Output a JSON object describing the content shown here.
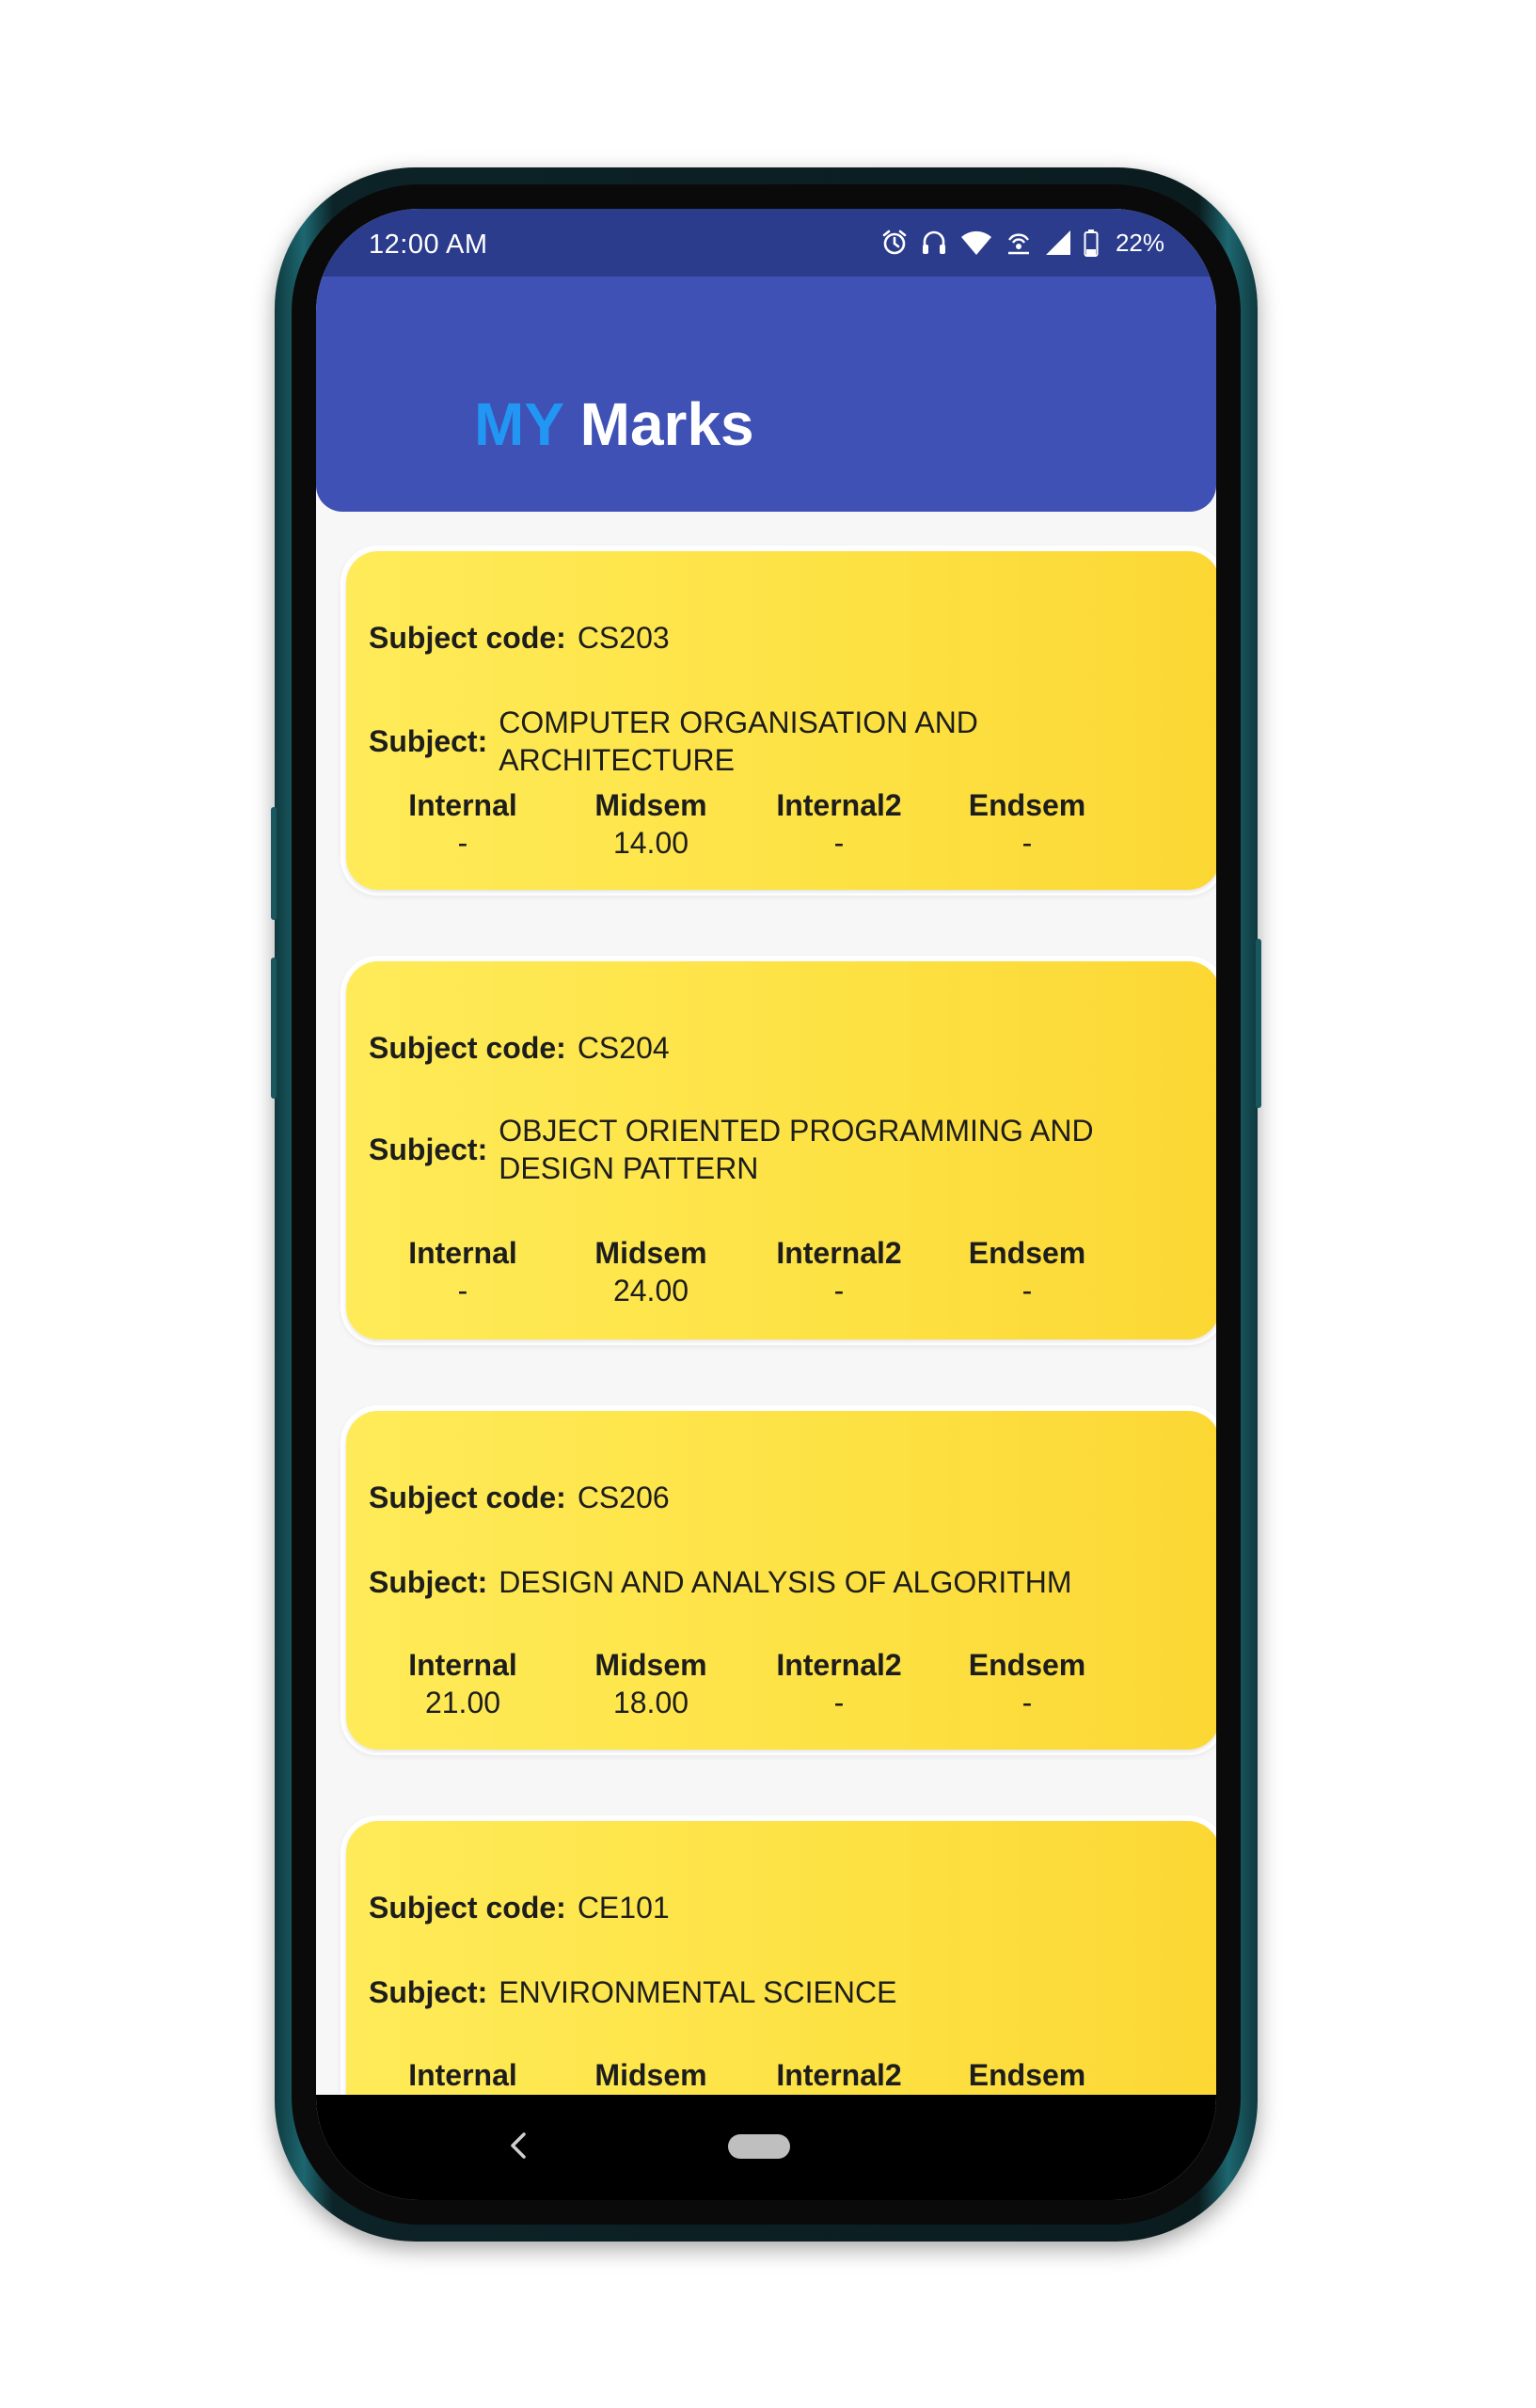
{
  "status_bar": {
    "time": "12:00 AM",
    "battery": "22%",
    "icons": [
      "alarm-icon",
      "headset-icon",
      "wifi-icon",
      "hotspot-icon",
      "signal-icon",
      "battery-icon"
    ]
  },
  "app_bar": {
    "title_accent": "MY",
    "title_rest": "Marks"
  },
  "labels": {
    "subject_code": "Subject code:",
    "subject": "Subject:",
    "internal": "Internal",
    "midsem": "Midsem",
    "internal2": "Internal2",
    "endsem": "Endsem"
  },
  "subjects": [
    {
      "code": "CS203",
      "name": "COMPUTER ORGANISATION AND ARCHITECTURE",
      "internal": "-",
      "midsem": "14.00",
      "internal2": "-",
      "endsem": "-"
    },
    {
      "code": "CS204",
      "name": "OBJECT ORIENTED PROGRAMMING AND DESIGN PATTERN",
      "internal": "-",
      "midsem": "24.00",
      "internal2": "-",
      "endsem": "-"
    },
    {
      "code": "CS206",
      "name": "DESIGN AND ANALYSIS OF ALGORITHM",
      "internal": "21.00",
      "midsem": "18.00",
      "internal2": "-",
      "endsem": "-"
    },
    {
      "code": "CE101",
      "name": "ENVIRONMENTAL SCIENCE",
      "internal": "",
      "midsem": "",
      "internal2": "",
      "endsem": ""
    }
  ],
  "colors": {
    "status_bar": "#2b3c8c",
    "app_bar": "#3f51b5",
    "title_accent": "#2196f3",
    "card_start": "#ffeb59",
    "card_end": "#fcd734"
  },
  "nav_bar": {
    "icons": [
      "back-icon",
      "home-icon"
    ]
  }
}
